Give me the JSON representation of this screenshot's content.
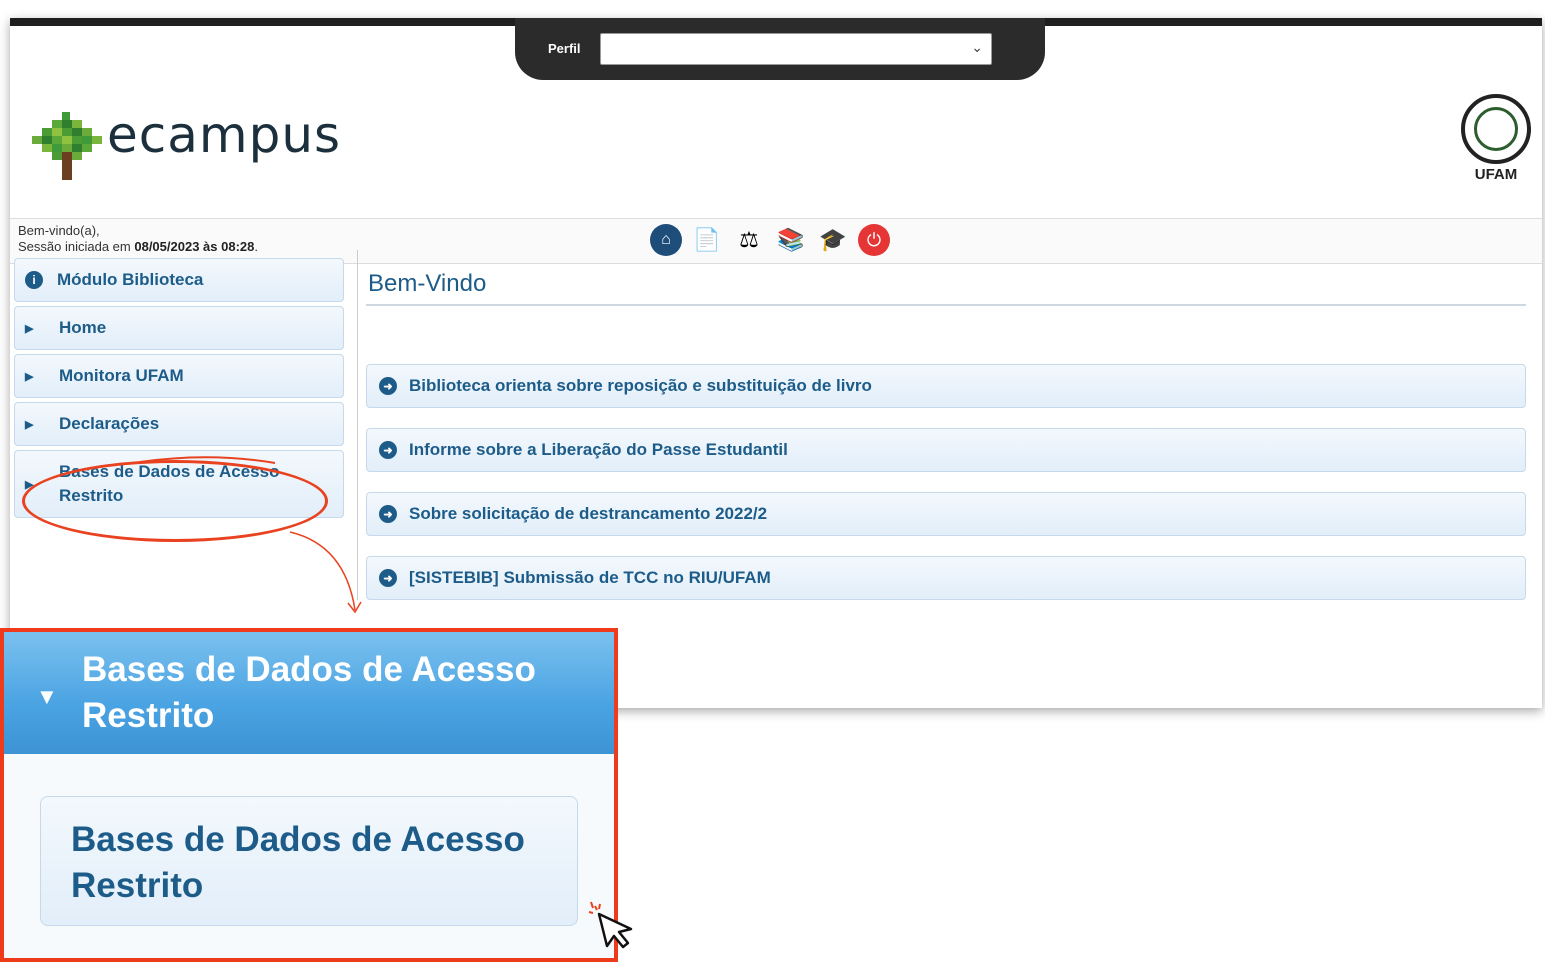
{
  "header": {
    "perfil_label": "Perfil",
    "perfil_value": "",
    "logo_text": "ecampus",
    "institution": "UFAM"
  },
  "session": {
    "welcome": "Bem-vindo(a),",
    "started_prefix": "Sessão iniciada em",
    "started_at": "08/05/2023 às 08:28",
    "started_suffix": "."
  },
  "toolbar": {
    "icons": [
      "home-icon",
      "document-settings-icon",
      "student-icon",
      "books-icon",
      "graduate-icon",
      "power-icon"
    ]
  },
  "sidebar": {
    "items": [
      {
        "label": "Módulo Biblioteca"
      },
      {
        "label": "Home"
      },
      {
        "label": "Monitora UFAM"
      },
      {
        "label": "Declarações"
      },
      {
        "label": "Bases de Dados de Acesso Restrito"
      }
    ]
  },
  "main": {
    "title": "Bem-Vindo",
    "news": [
      {
        "label": "Biblioteca orienta sobre reposição e substituição de livro"
      },
      {
        "label": "Informe sobre a Liberação do Passe Estudantil"
      },
      {
        "label": "Sobre solicitação de destrancamento 2022/2"
      },
      {
        "label": "[SISTEBIB] Submissão de TCC no RIU/UFAM"
      }
    ]
  },
  "zoom": {
    "header_line1": "Bases de Dados de Acesso",
    "header_line2": "Restrito",
    "item_line1": "Bases de Dados de Acesso",
    "item_line2": "Restrito"
  },
  "colors": {
    "accent": "#1d5c89",
    "highlight": "#ee3b1b",
    "zoom_header": "#4aa3e2"
  }
}
